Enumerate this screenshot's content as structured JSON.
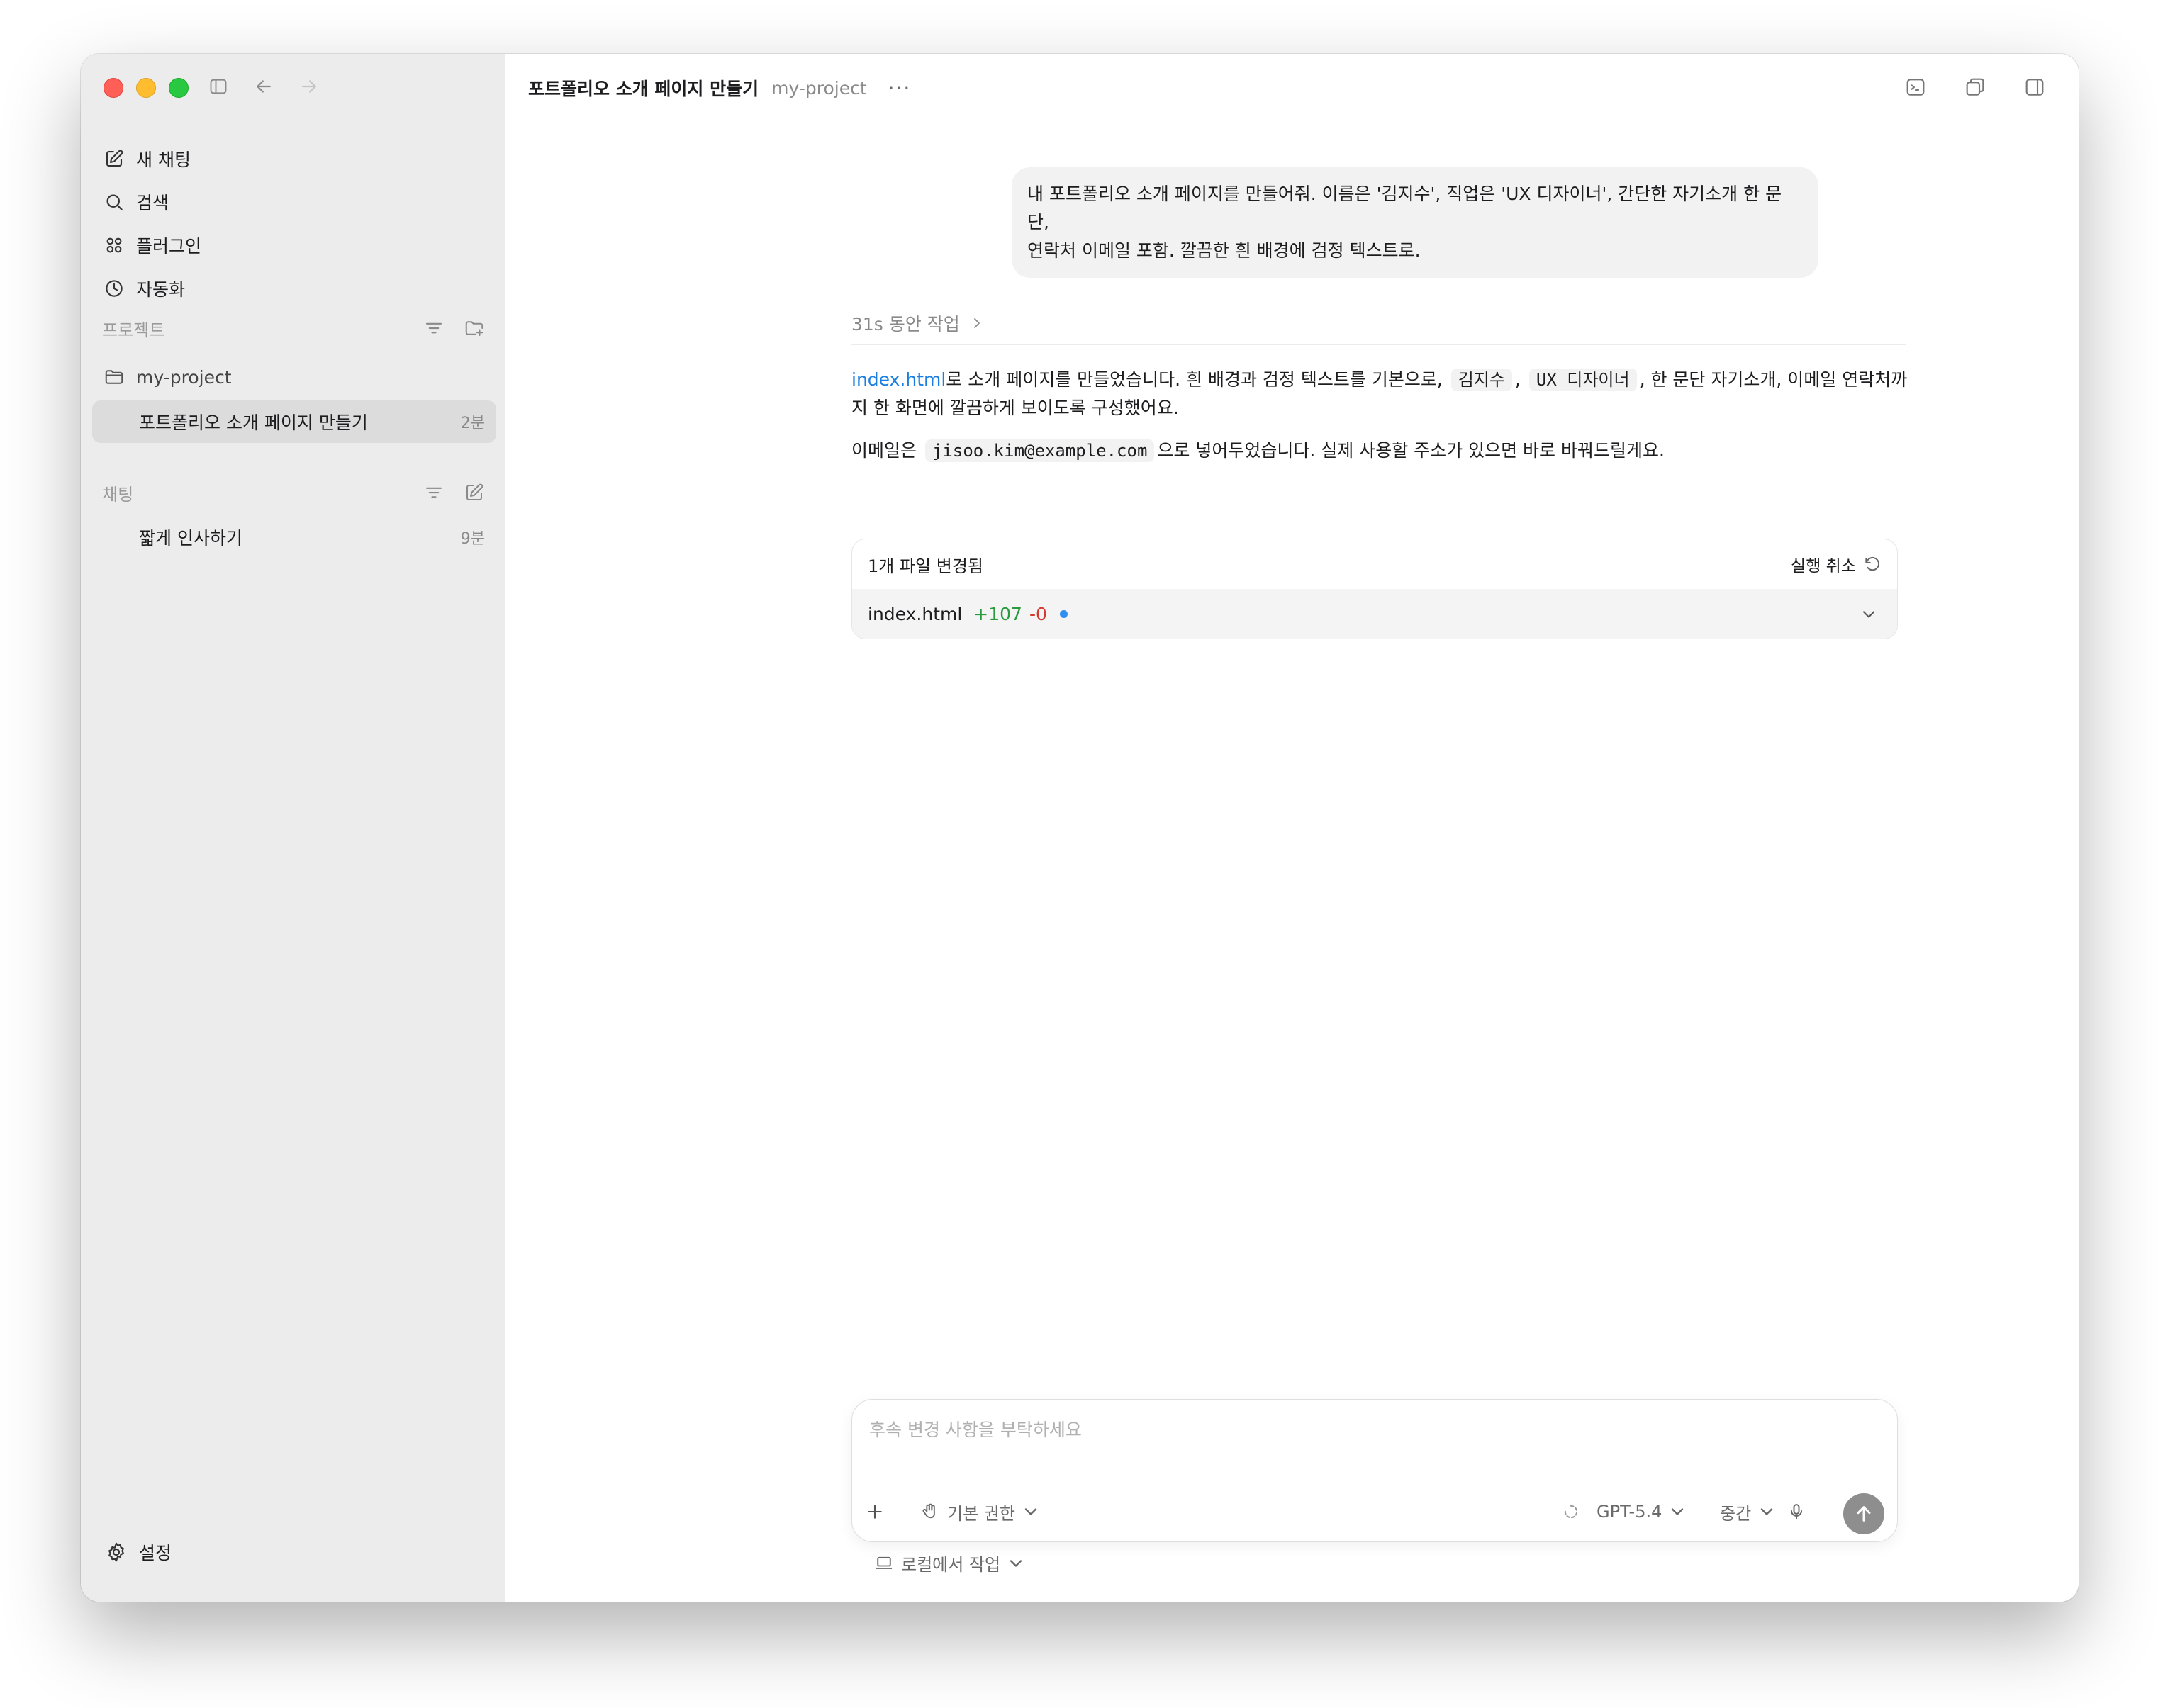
{
  "sidebar": {
    "nav": [
      {
        "label": "새 채팅",
        "icon": "edit-icon"
      },
      {
        "label": "검색",
        "icon": "search-icon"
      },
      {
        "label": "플러그인",
        "icon": "plugins-icon"
      },
      {
        "label": "자동화",
        "icon": "clock-icon"
      }
    ],
    "projects_label": "프로젝트",
    "project_folder": "my-project",
    "project_threads": [
      {
        "label": "포트폴리오 소개 페이지 만들기",
        "time": "2분",
        "active": true
      }
    ],
    "chats_label": "채팅",
    "chat_threads": [
      {
        "label": "짧게 인사하기",
        "time": "9분",
        "active": false
      }
    ],
    "settings_label": "설정"
  },
  "header": {
    "title": "포트폴리오 소개 페이지 만들기",
    "project": "my-project",
    "more": "···"
  },
  "conversation": {
    "user_message_line1": "내 포트폴리오 소개 페이지를 만들어줘. 이름은 '김지수', 직업은 'UX 디자이너', 간단한 자기소개 한 문단,",
    "user_message_line2": "연락처 이메일 포함. 깔끔한 흰 배경에 검정 텍스트로.",
    "worked_for": "31s 동안 작업",
    "response": {
      "p1_link": "index.html",
      "p1_a": "로 소개 페이지를 만들었습니다. 흰 배경과 검정 텍스트를 기본으로,",
      "p1_code1": "김지수",
      "p1_b": ",",
      "p1_code2": "UX 디자이너",
      "p1_c": ", 한 문단 자기소개, 이메일 연락처까지 한 화면에 깔끔하게 보이도록 구성했어요.",
      "p2_a": "이메일은",
      "p2_code": "jisoo.kim@example.com",
      "p2_b": "으로 넣어두었습니다. 실제 사용할 주소가 있으면 바로 바꿔드릴게요."
    }
  },
  "files_changed": {
    "title": "1개 파일 변경됨",
    "undo_label": "실행 취소",
    "files": [
      {
        "name": "index.html",
        "added": "+107",
        "removed": "-0"
      }
    ]
  },
  "composer": {
    "placeholder": "후속 변경 사항을 부탁하세요",
    "value": "",
    "permissions": "기본 권한",
    "model": "GPT-5.4",
    "effort": "중간",
    "local_work": "로컬에서 작업"
  },
  "colors": {
    "sidebar_bg": "#ececec",
    "link": "#1a7fe0",
    "added": "#2a9a3e",
    "removed": "#d33a2f",
    "unsaved_dot": "#2f8ff0",
    "send_button": "#8e8e8e"
  }
}
